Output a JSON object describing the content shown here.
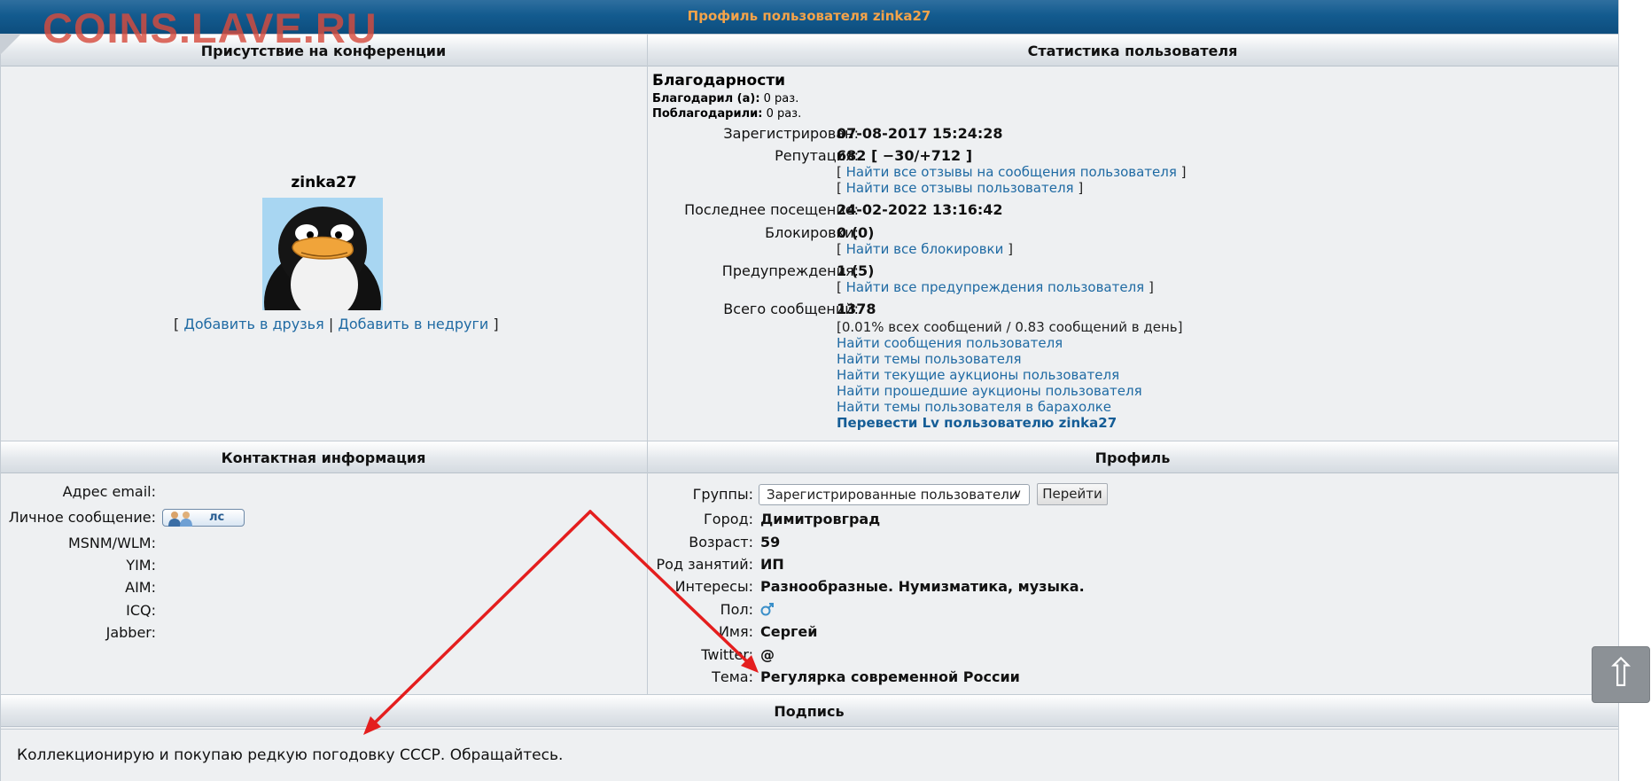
{
  "watermark": "COINS.LAVE.RU",
  "page_title": "Профиль пользователя zinka27",
  "sections": {
    "presence": "Присутствие на конференции",
    "stats": "Статистика пользователя",
    "contact": "Контактная информация",
    "profile": "Профиль",
    "signature": "Подпись"
  },
  "presence": {
    "username": "zinka27",
    "bracket_open": "[",
    "add_friend": "Добавить в друзья",
    "separator": "|",
    "add_foe": "Добавить в недруги",
    "bracket_close": "]"
  },
  "thanks": {
    "title": "Благодарности",
    "thanked_label": "Благодарил (а):",
    "thanked_value": "0 раз.",
    "was_thanked_label": "Поблагодарили:",
    "was_thanked_value": "0 раз."
  },
  "stats": {
    "registered_label": "Зарегистрирован:",
    "registered_value": "07-08-2017 15:24:28",
    "reputation_label": "Репутация:",
    "reputation_value": "682 [ −30/+712 ]",
    "reputation_link1": "Найти все отзывы на сообщения пользователя",
    "reputation_link2": "Найти все отзывы пользователя",
    "last_visit_label": "Последнее посещение:",
    "last_visit_value": "24-02-2022 13:16:42",
    "blocks_label": "Блокировки:",
    "blocks_value": "0 (0)",
    "blocks_link": "Найти все блокировки",
    "warnings_label": "Предупреждения:",
    "warnings_value": "1 (5)",
    "warnings_link": "Найти все предупреждения пользователя",
    "posts_label": "Всего сообщений:",
    "posts_value": "1378",
    "posts_detail": "[0.01% всех сообщений / 0.83 сообщений в день]",
    "links": [
      "Найти сообщения пользователя",
      "Найти темы пользователя",
      "Найти текущие аукционы пользователя",
      "Найти прошедшие аукционы пользователя",
      "Найти темы пользователя в барахолке"
    ],
    "transfer_link": "Перевести Lv пользователю zinka27",
    "bracket_open": "[",
    "bracket_close": "]"
  },
  "contact": {
    "email_label": "Адрес email:",
    "pm_label": "Личное сообщение:",
    "pm_button": "лс",
    "msnm_label": "MSNM/WLM:",
    "yim_label": "YIM:",
    "aim_label": "AIM:",
    "icq_label": "ICQ:",
    "jabber_label": "Jabber:"
  },
  "profile": {
    "groups_label": "Группы:",
    "groups_selected": "Зарегистрированные пользователи",
    "go_button": "Перейти",
    "city_label": "Город:",
    "city_value": "Димитровград",
    "age_label": "Возраст:",
    "age_value": "59",
    "occupation_label": "Род занятий:",
    "occupation_value": "ИП",
    "interests_label": "Интересы:",
    "interests_value": "Разнообразные. Нумизматика, музыка.",
    "gender_label": "Пол:",
    "name_label": "Имя:",
    "name_value": "Сергей",
    "twitter_label": "Twitter:",
    "twitter_value": "@",
    "topic_label": "Тема:",
    "topic_value": "Регулярка современной России"
  },
  "signature": {
    "text": "Коллекционирую и покупаю редкую погодовку СССР. Обращайтесь."
  },
  "scroll_top_icon": "⇧",
  "colors": {
    "header_bar": "#135b8f",
    "title_text": "#f3a34a",
    "link": "#1f6aa3",
    "annotation_arrow": "#e41e1e"
  }
}
